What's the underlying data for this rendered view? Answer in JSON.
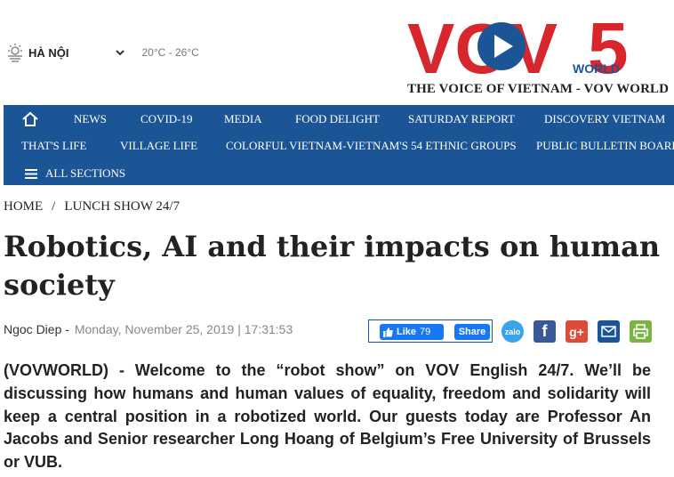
{
  "weather": {
    "city": "HÀ NỘI",
    "temperature": "20°C - 26°C",
    "icon": "sun-cloud-icon"
  },
  "brand": {
    "logo_text": "VOV",
    "logo_number": "5",
    "logo_sub": "WORLD",
    "tagline": "THE VOICE OF VIETNAM - VOV WORLD",
    "colors": {
      "red": "#d7262c",
      "blue": "#1c5596",
      "nav_bg": "#1c5596"
    }
  },
  "nav": {
    "row1": [
      "NEWS",
      "COVID-19",
      "MEDIA",
      "FOOD DELIGHT",
      "SATURDAY REPORT",
      "DISCOVERY VIETNAM"
    ],
    "row2": [
      "THAT'S LIFE",
      "VILLAGE LIFE",
      "COLORFUL VIETNAM-VIETNAM'S 54 ETHNIC GROUPS",
      "PUBLIC BULLETIN BOARD"
    ],
    "all_sections": "ALL SECTIONS"
  },
  "breadcrumb": {
    "home": "HOME",
    "separator": "/",
    "section": "LUNCH SHOW 24/7"
  },
  "article": {
    "title": "Robotics, AI and their impacts on human society",
    "author": "Ngoc Diep -",
    "date": "Monday, November 25, 2019 | 17:31:53",
    "lead": "(VOVWORLD) - Welcome to the “robot show” on VOV English 24/7. We’ll be discussing how humans and human values of equality, freedom and solidarity will keep a central position in a robotized world. Our guests today are Professor An Jacobs and Senior researcher Long Hoang of Belgium’s Free University of Brussels or VUB."
  },
  "social": {
    "like_label": "Like",
    "like_count": "79",
    "share_label": "Share",
    "zalo_label": "zalo",
    "facebook_label": "f",
    "google_label": "g+"
  }
}
